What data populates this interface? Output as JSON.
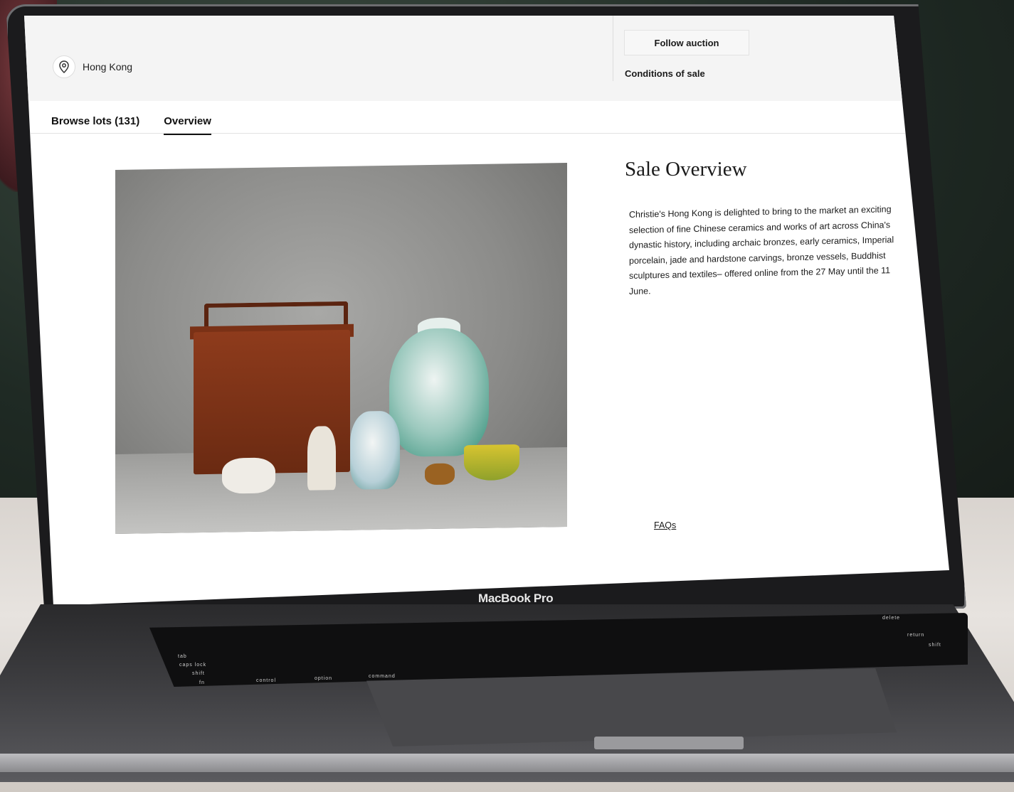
{
  "page": {
    "location": "Hong Kong",
    "follow_label": "Follow auction",
    "conditions_label": "Conditions of sale"
  },
  "tabs": [
    {
      "label": "Browse lots (131)",
      "active": false
    },
    {
      "label": "Overview",
      "active": true
    }
  ],
  "overview": {
    "title": "Sale Overview",
    "body": "Christie's Hong Kong is delighted to bring to the market an exciting selection of fine Chinese ceramics and works of art across China's dynastic history, including archaic bronzes, early ceramics, Imperial porcelain, jade and hardstone carvings, bronze vessels, Buddhist sculptures and textiles– offered online from the 27 May until the 11 June.",
    "faqs_label": "FAQs"
  },
  "device": {
    "brand": "MacBook Pro",
    "keys": [
      "tab",
      "caps lock",
      "shift",
      "fn",
      "control",
      "option",
      "command",
      "return",
      "shift",
      "delete"
    ]
  },
  "icons": {
    "location": "location-pin-icon"
  },
  "colors": {
    "page_bg": "#ffffff",
    "topbar_bg": "#f4f4f4",
    "text": "#1a1a1a"
  }
}
